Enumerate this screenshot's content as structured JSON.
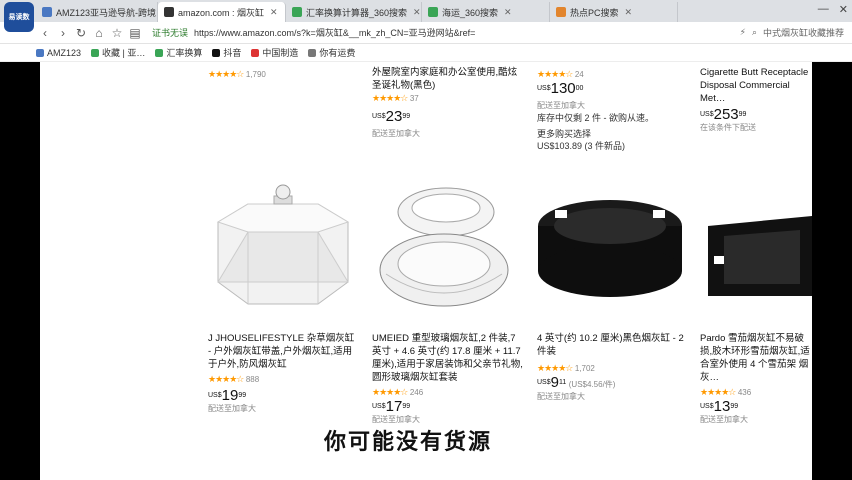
{
  "browser": {
    "logo_text": "易读数",
    "tabs": [
      {
        "label": "AMZ123亚马逊导航-跨境…",
        "color": "#4a78c2",
        "active": false
      },
      {
        "label": "amazon.com : 烟灰缸",
        "color": "#333333",
        "active": true
      },
      {
        "label": "汇率换算计算器_360搜索",
        "color": "#3aa556",
        "active": false
      },
      {
        "label": "海运_360搜索",
        "color": "#3aa556",
        "active": false
      },
      {
        "label": "热点PC搜索",
        "color": "#e2852d",
        "active": false
      }
    ],
    "address": {
      "secure_tag": "证书无误",
      "url": "https://www.amazon.com/s?k=烟灰缸&__mk_zh_CN=亚马逊网站&ref=",
      "right_text": "中式烟灰缸收藏推荐"
    },
    "bookmarks": [
      "AMZ123",
      "收藏 | 亚…",
      "汇率换算",
      "抖音",
      "中国制造",
      "你有运费"
    ]
  },
  "products_top": [
    {
      "stars": "★★★★☆",
      "reviews": "1,790"
    },
    {
      "title": "外屋院室内家庭和办公室使用,酷炫圣诞礼物(黑色)",
      "stars": "★★★★☆",
      "reviews": "37",
      "price_whole": "23",
      "price_frac": "99",
      "ship": "配送至加拿大"
    },
    {
      "stars": "★★★★☆",
      "reviews": "24",
      "price_whole": "130",
      "price_frac": "00",
      "ship": "配送至加拿大",
      "stock": "库存中仅剩 2 件 - 欲购从速。",
      "more": "更多购买选择",
      "more_price": "US$103.89 (3 件新品)"
    },
    {
      "title": "Cigarette Butt Receptacle Disposal Commercial Met…",
      "price_whole": "253",
      "price_frac": "99",
      "ship": "在该条件下配送"
    }
  ],
  "products": [
    {
      "title": "J JHOUSELIFESTYLE 杂草烟灰缸 - 户外烟灰缸带盖,户外烟灰缸,适用于户外,防风烟灰缸",
      "stars": "★★★★☆",
      "reviews": "888",
      "price_whole": "19",
      "price_frac": "99",
      "ship": "配送至加拿大"
    },
    {
      "title": "UMEIED 重型玻璃烟灰缸,2 件装,7 英寸 + 4.6 英寸(约 17.8 厘米 + 11.7 厘米),适用于家居装饰和父亲节礼物,圆形玻璃烟灰缸套装",
      "stars": "★★★★☆",
      "reviews": "246",
      "price_whole": "17",
      "price_frac": "99",
      "ship": "配送至加拿大"
    },
    {
      "title": "4 英寸(约 10.2 厘米)黑色烟灰缸 - 2 件装",
      "stars": "★★★★☆",
      "reviews": "1,702",
      "price_whole": "9",
      "price_frac": "11",
      "unit": "(US$4.56/件)",
      "ship": "配送至加拿大"
    },
    {
      "title": "Pardo 雪茄烟灰缸不易破损,胶木环形雪茄烟灰缸,适合室外使用 4 个雪茄架 烟灰…",
      "stars": "★★★★☆",
      "reviews": "436",
      "price_whole": "13",
      "price_frac": "99",
      "ship": "配送至加拿大"
    }
  ],
  "price_currency": "US$",
  "subtitle": "你可能没有货源",
  "colors": {
    "star": "#ff9900",
    "link": "#007185",
    "tab_bar": "#dde0e4"
  }
}
